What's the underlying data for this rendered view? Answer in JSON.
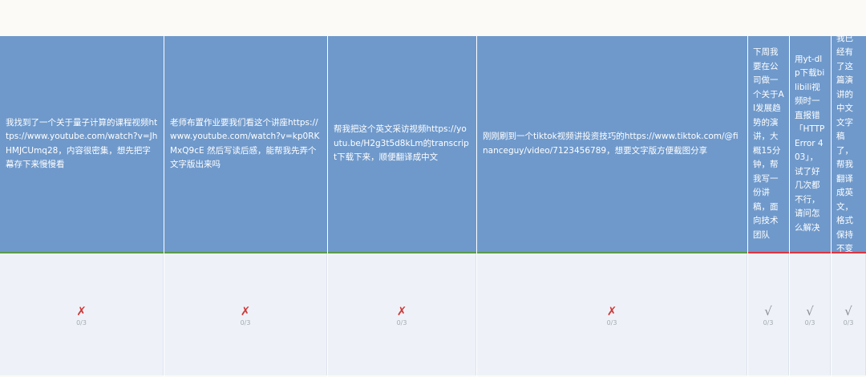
{
  "table": {
    "columns": [
      {
        "prompt": "我找到了一个关于量子计算的课程视频https://www.youtube.com/watch?v=JhHMJCUmq28，内容很密集，想先把字幕存下来慢慢看",
        "result_icon": "cross-mark",
        "score": "0/3"
      },
      {
        "prompt": "老师布置作业要我们看这个讲座https://www.youtube.com/watch?v=kp0RKMxQ9cE 然后写读后感，能帮我先弄个文字版出来吗",
        "result_icon": "cross-mark",
        "score": "0/3"
      },
      {
        "prompt": "帮我把这个英文采访视频https://youtu.be/H2g3t5d8kLm的transcript下载下来，顺便翻译成中文",
        "result_icon": "cross-mark",
        "score": "0/3"
      },
      {
        "prompt": "刚刚刷到一个tiktok视频讲投资技巧的https://www.tiktok.com/@financeguy/video/7123456789，想要文字版方便截图分享",
        "result_icon": "cross-mark",
        "score": "0/3"
      },
      {
        "prompt": "下周我要在公司做一个关于AI发展趋势的演讲，大概15分钟，帮我写一份讲稿，面向技术团队",
        "result_icon": "check-mark",
        "score": "0/3"
      },
      {
        "prompt": "用yt-dlp下载bilibili视频时一直报错「HTTP Error 403」，试了好几次都不行，请问怎么解决",
        "result_icon": "check-mark",
        "score": "0/3"
      },
      {
        "prompt": "我已经有了这篇演讲的中文文字稿了，帮我翻译成英文，格式保持不变",
        "result_icon": "check-mark",
        "score": "0/3"
      }
    ],
    "marks": {
      "cross": "✗",
      "check": "√"
    },
    "colors": {
      "header_bg": "#6f99cb",
      "body_bg": "#eef2f8",
      "fail": "#cc3b3b",
      "pass": "#8a8f95",
      "green_rule": "#5a9a4a",
      "red_rule": "#e0343f"
    }
  }
}
